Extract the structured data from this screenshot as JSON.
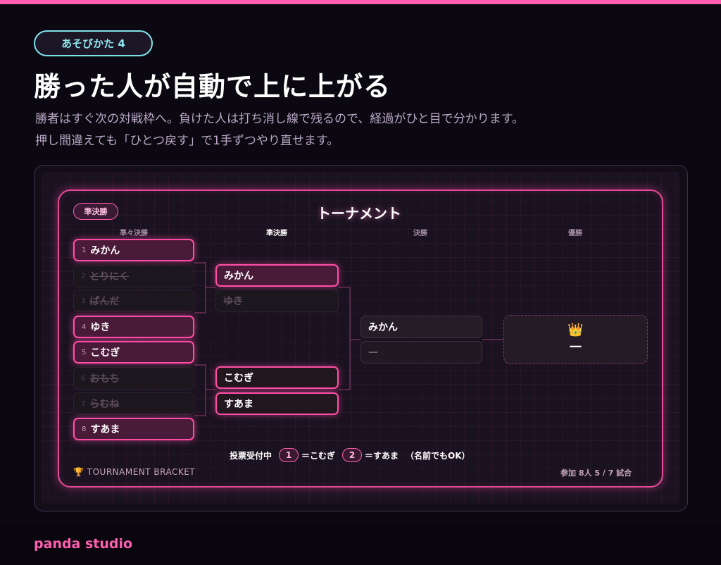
{
  "header": {
    "pill_label": "あそびかた 4",
    "title": "勝った人が自動で上に上がる",
    "desc_line1": "勝者はすぐ次の対戦枠へ。負けた人は打ち消し線で残るので、経過がひと目で分かります。",
    "desc_line2": "押し間違えても「ひとつ戻す」で1手ずつやり直せます。"
  },
  "bracket": {
    "round_badge": "準決勝",
    "title": "トーナメント",
    "rounds": [
      "準々決勝",
      "準決勝",
      "決勝",
      "優勝"
    ],
    "quarterfinals": [
      {
        "seed": "1",
        "name": "みかん",
        "state": "win"
      },
      {
        "seed": "2",
        "name": "とりにく",
        "state": "lose"
      },
      {
        "seed": "3",
        "name": "ぱんだ",
        "state": "lose"
      },
      {
        "seed": "4",
        "name": "ゆき",
        "state": "win"
      },
      {
        "seed": "5",
        "name": "こむぎ",
        "state": "win"
      },
      {
        "seed": "6",
        "name": "おもち",
        "state": "lose"
      },
      {
        "seed": "7",
        "name": "らむね",
        "state": "lose"
      },
      {
        "seed": "8",
        "name": "すあま",
        "state": "win"
      }
    ],
    "semifinals": [
      {
        "name": "みかん",
        "state": "win"
      },
      {
        "name": "ゆき",
        "state": "lose"
      },
      {
        "name": "こむぎ",
        "state": "active"
      },
      {
        "name": "すあま",
        "state": "active"
      }
    ],
    "final": [
      {
        "name": "みかん",
        "state": "pending"
      },
      {
        "name": "—",
        "state": "empty"
      }
    ],
    "champion": {
      "icon": "crown-icon",
      "crown_glyph": "👑",
      "name": "—"
    },
    "vote": {
      "label": "投票受付中",
      "opt1_num": "1",
      "opt1_text": "＝こむぎ",
      "opt2_num": "2",
      "opt2_text": "＝すあま",
      "note": "（名前でもOK）"
    },
    "footer_left": "🏆 TOURNAMENT BRACKET",
    "footer_right": "参加 8人 5 / 7 試合"
  },
  "brand": "panda studio",
  "colors": {
    "accent": "#ff5fb0",
    "pill_border": "#7fe3ec",
    "background": "#0b0811"
  }
}
